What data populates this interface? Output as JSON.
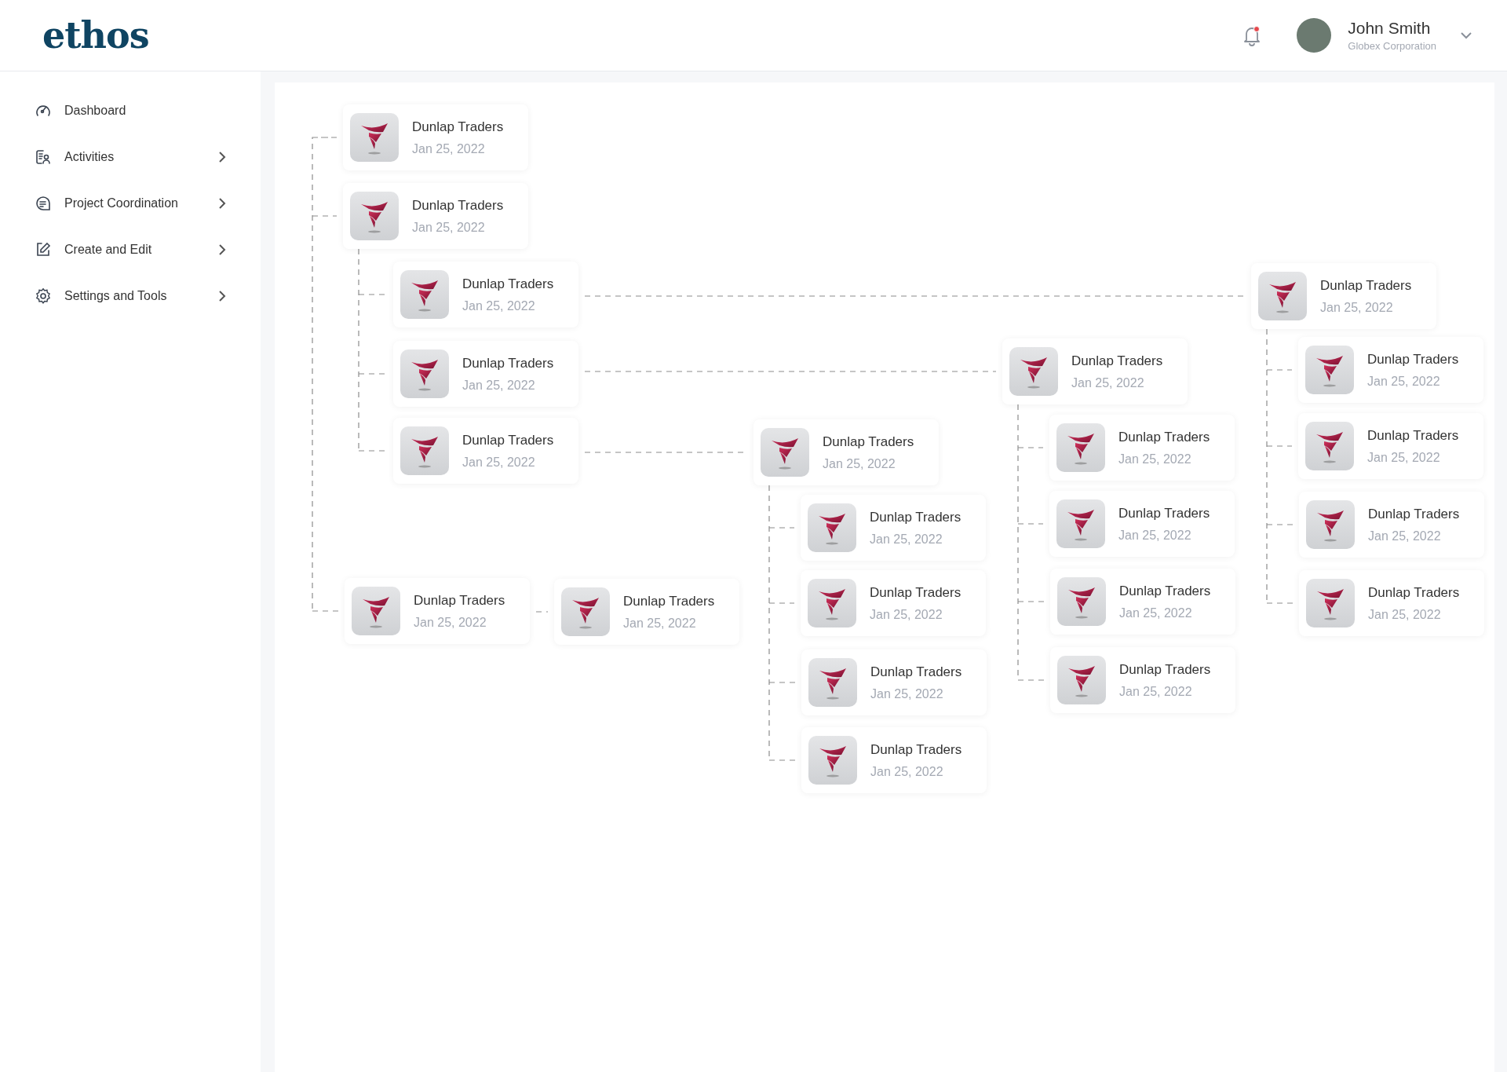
{
  "header": {
    "logo": "ethos",
    "user": {
      "name": "John Smith",
      "company": "Globex Corporation"
    },
    "notifications_unread": true
  },
  "sidebar": {
    "items": [
      {
        "label": "Dashboard",
        "expandable": false
      },
      {
        "label": "Activities",
        "expandable": true
      },
      {
        "label": "Project Coordination",
        "expandable": true
      },
      {
        "label": "Create and Edit",
        "expandable": true
      },
      {
        "label": "Settings and Tools",
        "expandable": true
      }
    ]
  },
  "tree": {
    "nodes": [
      {
        "name": "Dunlap Traders",
        "date": "Jan 25, 2022"
      },
      {
        "name": "Dunlap Traders",
        "date": "Jan 25, 2022",
        "children": [
          {
            "name": "Dunlap Traders",
            "date": "Jan 25, 2022",
            "children": [
              {
                "name": "Dunlap Traders",
                "date": "Jan 25, 2022",
                "children": [
                  {
                    "name": "Dunlap Traders",
                    "date": "Jan 25, 2022"
                  },
                  {
                    "name": "Dunlap Traders",
                    "date": "Jan 25, 2022"
                  },
                  {
                    "name": "Dunlap Traders",
                    "date": "Jan 25, 2022"
                  },
                  {
                    "name": "Dunlap Traders",
                    "date": "Jan 25, 2022"
                  }
                ]
              }
            ]
          },
          {
            "name": "Dunlap Traders",
            "date": "Jan 25, 2022",
            "children": [
              {
                "name": "Dunlap Traders",
                "date": "Jan 25, 2022",
                "children": [
                  {
                    "name": "Dunlap Traders",
                    "date": "Jan 25, 2022"
                  },
                  {
                    "name": "Dunlap Traders",
                    "date": "Jan 25, 2022"
                  },
                  {
                    "name": "Dunlap Traders",
                    "date": "Jan 25, 2022"
                  },
                  {
                    "name": "Dunlap Traders",
                    "date": "Jan 25, 2022"
                  }
                ]
              }
            ]
          },
          {
            "name": "Dunlap Traders",
            "date": "Jan 25, 2022",
            "children": [
              {
                "name": "Dunlap Traders",
                "date": "Jan 25, 2022",
                "children": [
                  {
                    "name": "Dunlap Traders",
                    "date": "Jan 25, 2022"
                  },
                  {
                    "name": "Dunlap Traders",
                    "date": "Jan 25, 2022"
                  },
                  {
                    "name": "Dunlap Traders",
                    "date": "Jan 25, 2022"
                  },
                  {
                    "name": "Dunlap Traders",
                    "date": "Jan 25, 2022"
                  }
                ]
              }
            ]
          }
        ]
      },
      {
        "name": "Dunlap Traders",
        "date": "Jan 25, 2022",
        "children": [
          {
            "name": "Dunlap Traders",
            "date": "Jan 25, 2022"
          }
        ]
      }
    ]
  }
}
